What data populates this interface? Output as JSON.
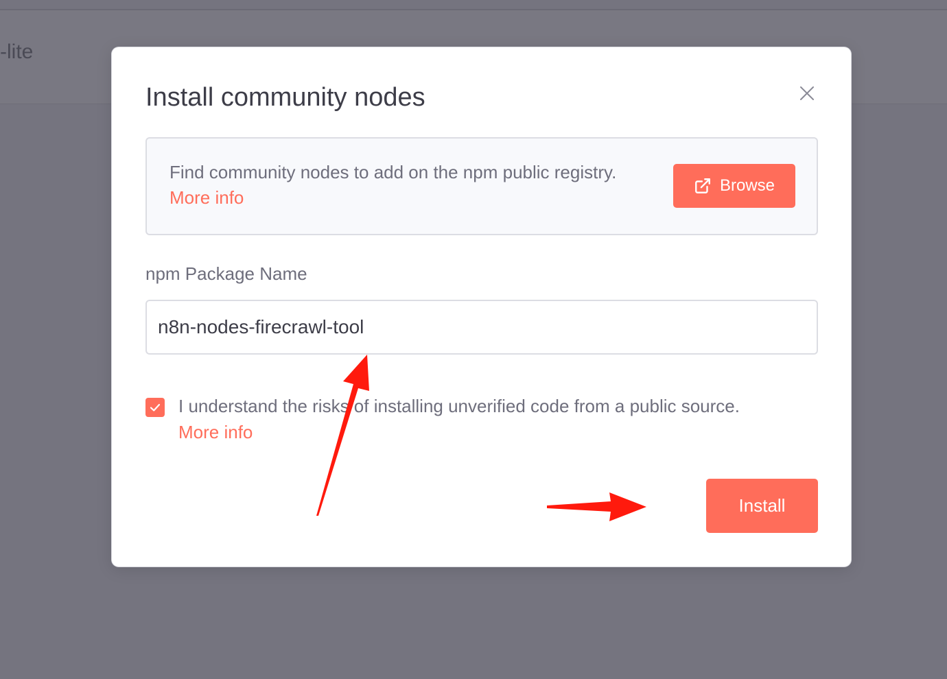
{
  "background": {
    "title_fragment": "-lite"
  },
  "modal": {
    "title": "Install community nodes",
    "close_icon": "close-icon",
    "info": {
      "text": "Find community nodes to add on the npm public registry.",
      "more_info": "More info",
      "browse_label": "Browse",
      "browse_icon": "external-link-icon"
    },
    "package_field": {
      "label": "npm Package Name",
      "value": "n8n-nodes-firecrawl-tool"
    },
    "consent": {
      "checked": true,
      "text": "I understand the risks of installing unverified code from a public source.",
      "more_info": "More info"
    },
    "install_label": "Install"
  },
  "colors": {
    "accent": "#ff6d5a",
    "annotation": "#ff1a0d",
    "overlay": "#75747f",
    "text_primary": "#3d3d48",
    "text_secondary": "#6e6e7c"
  }
}
